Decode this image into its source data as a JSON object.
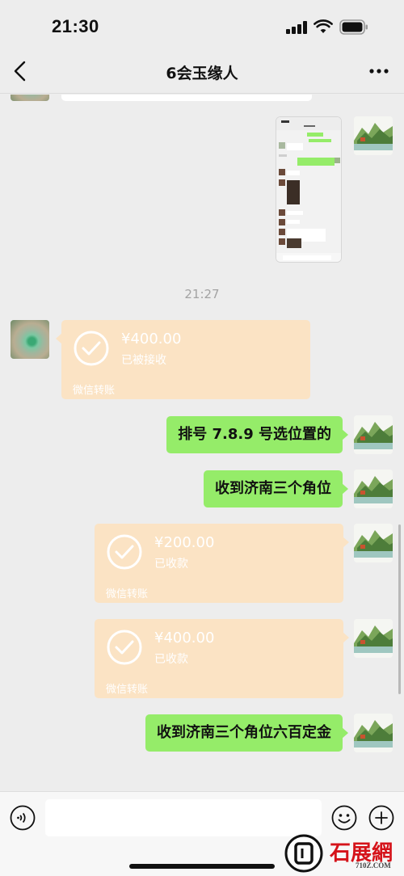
{
  "status_bar": {
    "time": "21:30"
  },
  "header": {
    "title": "6会玉缘人"
  },
  "messages": {
    "timestamp": "21:27",
    "transfer_received": {
      "amount": "¥400.00",
      "status": "已被接收",
      "label": "微信转账"
    },
    "text_1": "排号 7.8.9 号选位置的",
    "text_2": "收到济南三个角位",
    "transfer_1": {
      "amount": "¥200.00",
      "status": "已收款",
      "label": "微信转账"
    },
    "transfer_2": {
      "amount": "¥400.00",
      "status": "已收款",
      "label": "微信转账"
    },
    "text_3": "收到济南三个角位六百定金"
  },
  "watermark": {
    "brand": "石展網",
    "site": "710Z.COM"
  },
  "icons": [
    "back-icon",
    "more-icon",
    "signal-icon",
    "wifi-icon",
    "battery-icon",
    "check-icon",
    "voice-icon",
    "emoji-icon",
    "plus-icon"
  ],
  "colors": {
    "self_bubble": "#95ec69",
    "transfer_card": "#fbe3c4",
    "background": "#ededed"
  }
}
